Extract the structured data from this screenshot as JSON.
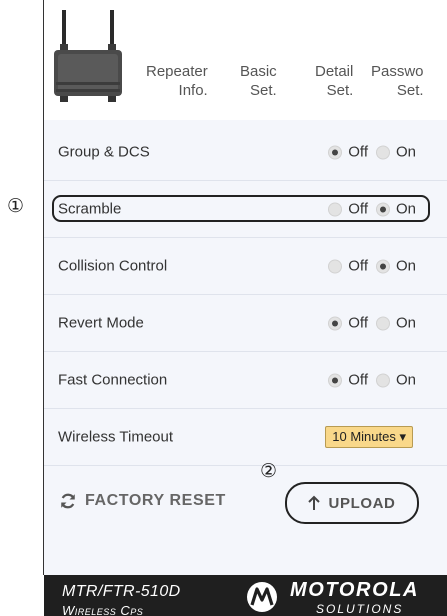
{
  "tabs": [
    {
      "line1": "Repeater",
      "line2": "Info."
    },
    {
      "line1": "Basic",
      "line2": "Set."
    },
    {
      "line1": "Detail",
      "line2": "Set."
    },
    {
      "line1": "Passwo",
      "line2": "Set."
    }
  ],
  "settings": [
    {
      "label": "Group & DCS",
      "off_label": "Off",
      "on_label": "On",
      "value": "Off"
    },
    {
      "label": "Scramble",
      "off_label": "Off",
      "on_label": "On",
      "value": "On"
    },
    {
      "label": "Collision Control",
      "off_label": "Off",
      "on_label": "On",
      "value": "On"
    },
    {
      "label": "Revert Mode",
      "off_label": "Off",
      "on_label": "On",
      "value": "Off"
    },
    {
      "label": "Fast Connection",
      "off_label": "Off",
      "on_label": "On",
      "value": "Off"
    },
    {
      "label": "Wireless Timeout",
      "select_value": "10 Minutes ▾"
    }
  ],
  "callouts": {
    "one": "①",
    "two": "②"
  },
  "actions": {
    "factory_reset": "FACTORY RESET",
    "upload": "UPLOAD"
  },
  "footer": {
    "model": "MTR/FTR-510D",
    "tagline": "Wireless Cps",
    "brand": "MOTOROLA",
    "brand_sub": "SOLUTIONS"
  },
  "icons": {
    "refresh": "refresh-icon",
    "upload": "arrow-up-icon",
    "logo": "motorola-logo-icon",
    "device": "repeater-device-image"
  },
  "colors": {
    "panel": "#f4f6fb",
    "select": "#f9d88a",
    "footer": "#1f1f1f"
  }
}
